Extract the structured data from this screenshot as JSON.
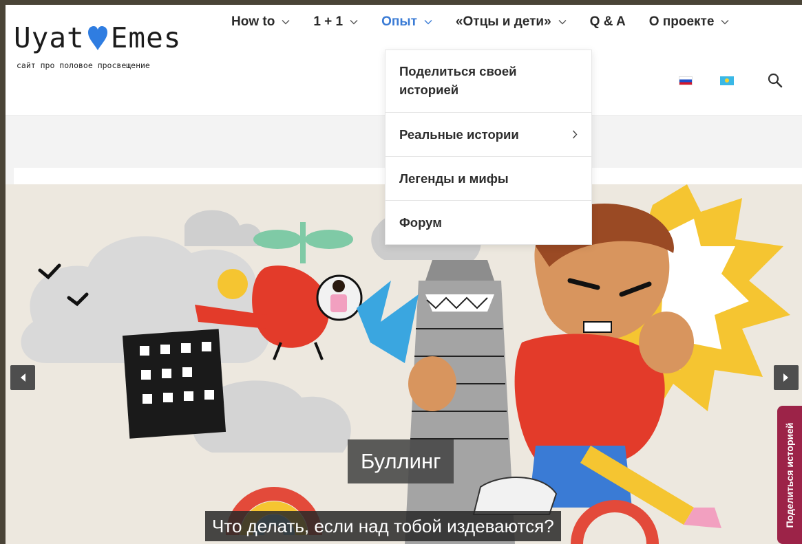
{
  "logo": {
    "part1": "Uyat",
    "part2": "Emes",
    "tagline": "сайт про половое просвещение",
    "heart_color": "#2f7de1"
  },
  "nav": {
    "items": [
      {
        "label": "How to",
        "has_dropdown": true
      },
      {
        "label": "1 + 1",
        "has_dropdown": true
      },
      {
        "label": "Опыт",
        "has_dropdown": true,
        "active": true
      },
      {
        "label": "«Отцы и дети»",
        "has_dropdown": true
      },
      {
        "label": "Q & A",
        "has_dropdown": false
      },
      {
        "label": "О проекте",
        "has_dropdown": true
      }
    ],
    "active_color": "#3a7bd5"
  },
  "dropdown": {
    "items": [
      {
        "label": "Поделиться своей историей"
      },
      {
        "label": "Реальные истории",
        "has_submenu": true
      },
      {
        "label": "Легенды и мифы"
      },
      {
        "label": "Форум"
      }
    ]
  },
  "languages": [
    {
      "icon": "flag-russia-icon"
    },
    {
      "icon": "flag-kazakhstan-icon"
    }
  ],
  "search": {
    "icon": "search-icon"
  },
  "slider": {
    "title": "Буллинг",
    "subtitle": "Что делать, если над тобой издеваются?",
    "prev_icon": "chevron-left-icon",
    "next_icon": "chevron-right-icon"
  },
  "side_tab": {
    "label": "Поделиться историей",
    "color": "#9c2348"
  }
}
